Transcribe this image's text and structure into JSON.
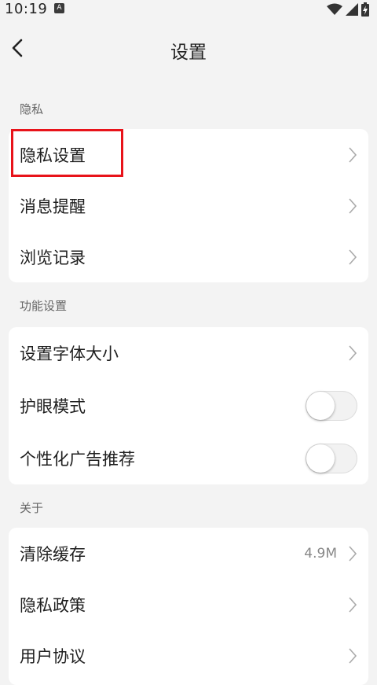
{
  "status_bar": {
    "time": "10:19",
    "notif_icon_letter": "A"
  },
  "header": {
    "title": "设置"
  },
  "sections": [
    {
      "label": "隐私",
      "items": [
        {
          "label": "隐私设置",
          "type": "link"
        },
        {
          "label": "消息提醒",
          "type": "link"
        },
        {
          "label": "浏览记录",
          "type": "link"
        }
      ]
    },
    {
      "label": "功能设置",
      "items": [
        {
          "label": "设置字体大小",
          "type": "link"
        },
        {
          "label": "护眼模式",
          "type": "toggle",
          "on": false
        },
        {
          "label": "个性化广告推荐",
          "type": "toggle",
          "on": false
        }
      ]
    },
    {
      "label": "关于",
      "items": [
        {
          "label": "清除缓存",
          "type": "link",
          "value": "4.9M"
        },
        {
          "label": "隐私政策",
          "type": "link"
        },
        {
          "label": "用户协议",
          "type": "link"
        }
      ]
    }
  ],
  "colors": {
    "background": "#f3f3f3",
    "card": "#ffffff",
    "highlight": "#e8131a"
  }
}
